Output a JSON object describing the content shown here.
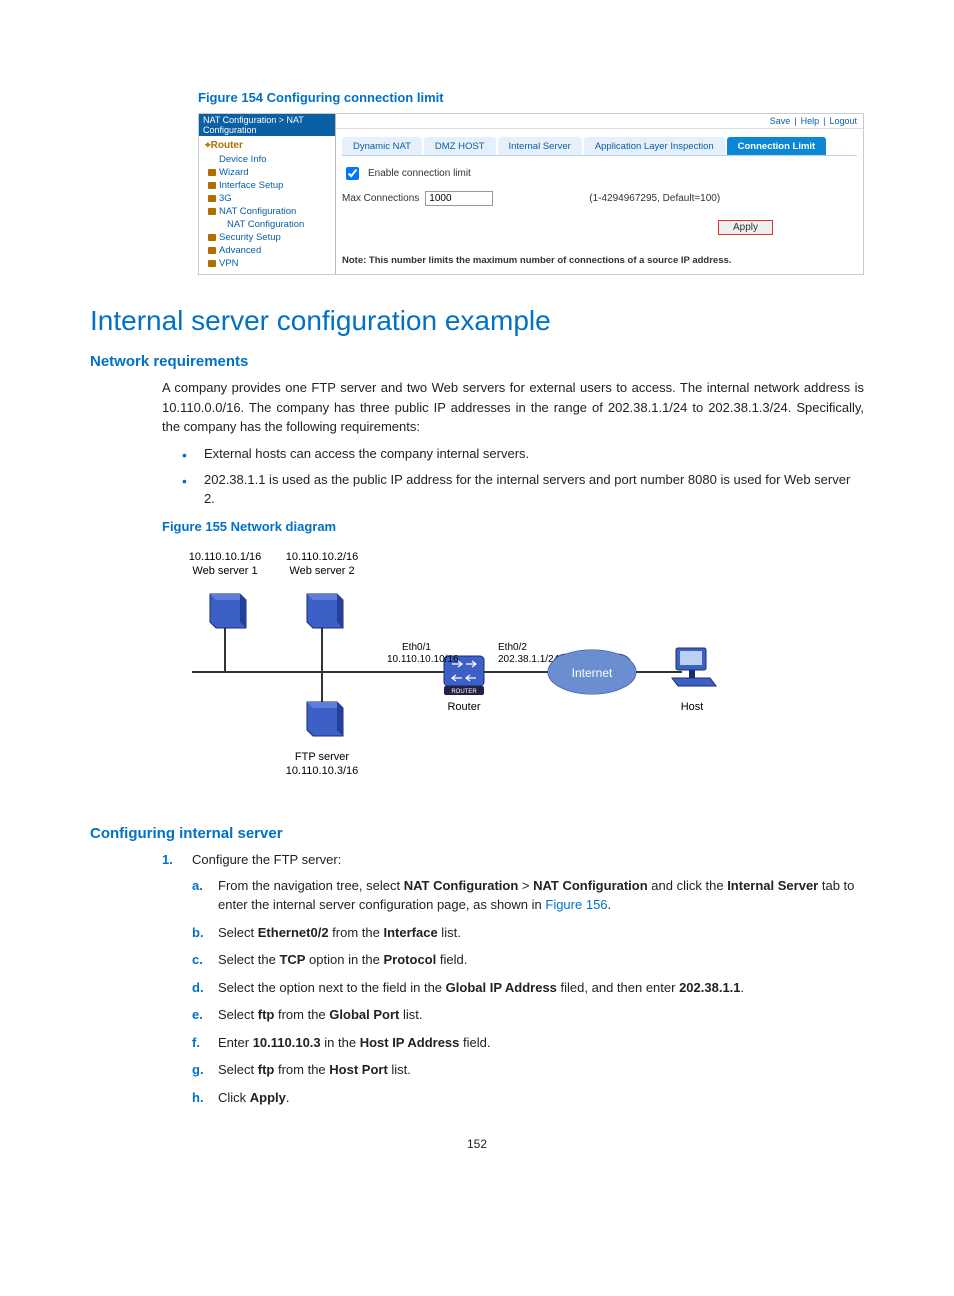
{
  "figure154": {
    "caption": "Figure 154 Configuring connection limit",
    "breadcrumb": "NAT Configuration > NAT Configuration",
    "toplinks": [
      "Save",
      "Help",
      "Logout"
    ],
    "navroot": "Router",
    "nav": [
      {
        "label": "Device Info"
      },
      {
        "label": "Wizard",
        "folder": true
      },
      {
        "label": "Interface Setup",
        "folder": true
      },
      {
        "label": "3G",
        "folder": true
      },
      {
        "label": "NAT Configuration",
        "folder": true
      },
      {
        "label": "NAT Configuration",
        "sub": true
      },
      {
        "label": "Security Setup",
        "folder": true
      },
      {
        "label": "Advanced",
        "folder": true
      },
      {
        "label": "VPN",
        "folder": true
      }
    ],
    "tabs": [
      "Dynamic NAT",
      "DMZ HOST",
      "Internal Server",
      "Application Layer Inspection",
      "Connection Limit"
    ],
    "activeTab": 4,
    "enableLabel": "Enable connection limit",
    "maxConnLabel": "Max Connections",
    "maxConnValue": "1000",
    "maxConnHint": "(1-4294967295, Default=100)",
    "apply": "Apply",
    "note": "Note: This number limits the maximum number of connections of a source IP address."
  },
  "section": {
    "title": "Internal server configuration example"
  },
  "netreq": {
    "heading": "Network requirements",
    "para": "A company provides one FTP server and two Web servers for external users to access. The internal network address is 10.110.0.0/16. The company has three public IP addresses in the range of 202.38.1.1/24 to 202.38.1.3/24. Specifically, the company has the following requirements:",
    "items": [
      "External hosts can access the company internal servers.",
      "202.38.1.1 is used as the public IP address for the internal servers and port number 8080 is used for Web server 2."
    ]
  },
  "figure155": {
    "caption": "Figure 155 Network diagram",
    "labels": {
      "ws1ip": "10.110.10.1/16",
      "ws1": "Web server 1",
      "ws2ip": "10.110.10.2/16",
      "ws2": "Web server 2",
      "eth01": "Eth0/1",
      "eth01ip": "10.110.10.10/16",
      "eth02": "Eth0/2",
      "eth02ip": "202.38.1.1/24",
      "router": "Router",
      "internet": "Internet",
      "host": "Host",
      "ftp": "FTP server",
      "ftpip": "10.110.10.3/16"
    }
  },
  "config": {
    "heading": "Configuring internal server",
    "step1": "Configure the FTP server:",
    "a_pre": "From the navigation tree, select ",
    "a_b1": "NAT Configuration",
    "a_gt": " > ",
    "a_b2": "NAT Configuration",
    "a_mid": " and click the ",
    "a_b3": "Internal Server",
    "a_post": " tab to enter the internal server configuration page, as shown in ",
    "a_link": "Figure 156",
    "a_dot": ".",
    "b_pre": "Select ",
    "b_b1": "Ethernet0/2",
    "b_mid": " from the ",
    "b_b2": "Interface",
    "b_post": " list.",
    "c_pre": "Select the ",
    "c_b1": "TCP",
    "c_mid": " option in the ",
    "c_b2": "Protocol",
    "c_post": " field.",
    "d_pre": "Select the option next to the field in the ",
    "d_b1": "Global IP Address",
    "d_mid": " filed, and then enter ",
    "d_b2": "202.38.1.1",
    "d_post": ".",
    "e_pre": "Select ",
    "e_b1": "ftp",
    "e_mid": " from the ",
    "e_b2": "Global Port",
    "e_post": " list.",
    "f_pre": "Enter ",
    "f_b1": "10.110.10.3",
    "f_mid": " in the ",
    "f_b2": "Host IP Address",
    "f_post": " field.",
    "g_pre": "Select ",
    "g_b1": "ftp",
    "g_mid": " from the ",
    "g_b2": "Host Port",
    "g_post": " list.",
    "h_pre": "Click ",
    "h_b1": "Apply",
    "h_post": "."
  },
  "pagenum": "152"
}
